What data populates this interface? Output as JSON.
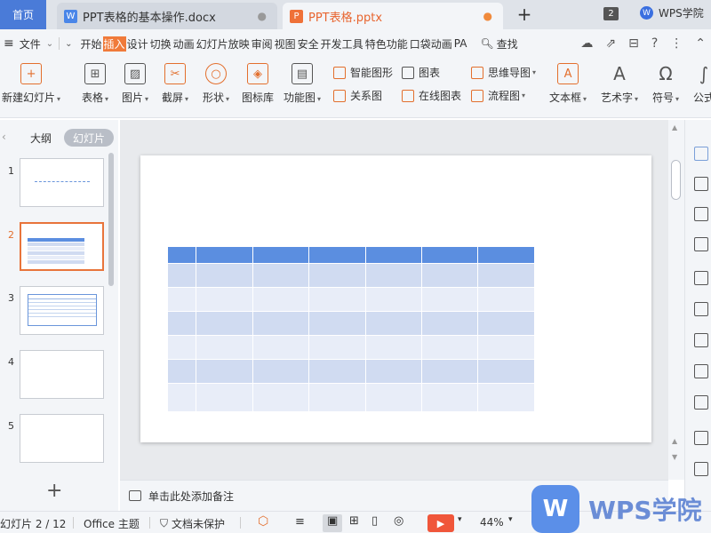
{
  "tabs": {
    "home": "首页",
    "doc": {
      "title": "PPT表格的基本操作.docx",
      "icon": "W"
    },
    "ppt": {
      "title": "PPT表格.pptx",
      "icon": "P"
    },
    "window_count": "2",
    "account": "WPS学院"
  },
  "menu": {
    "file": "文件",
    "tabs": [
      "开始",
      "插入",
      "设计",
      "切换",
      "动画",
      "幻灯片放映",
      "审阅",
      "视图",
      "安全",
      "开发工具",
      "特色功能",
      "口袋动画",
      "PA"
    ],
    "active_tab": "插入",
    "search": "查找"
  },
  "ribbon": {
    "new_slide": "新建幻灯片",
    "table": "表格",
    "picture": "图片",
    "screenshot": "截屏",
    "shape": "形状",
    "icon_lib": "图标库",
    "function_chart": "功能图",
    "smart_graphic": "智能图形",
    "chart": "图表",
    "mind_map": "思维导图",
    "relation_chart": "关系图",
    "online_chart": "在线图表",
    "flow_chart": "流程图",
    "textbox": "文本框",
    "wordart": "艺术字",
    "symbol": "符号",
    "formula": "公式"
  },
  "left_panel": {
    "outline": "大纲",
    "slides": "幻灯片",
    "slide_numbers": [
      "1",
      "2",
      "3",
      "4",
      "5"
    ],
    "active_slide": "2"
  },
  "notes": {
    "placeholder": "单击此处添加备注"
  },
  "status": {
    "slide_position": "幻灯片 2 / 12",
    "theme": "Office 主题",
    "protection": "文档未保护",
    "zoom": "44%"
  },
  "watermark": {
    "logo": "W",
    "text": "WPS学院"
  },
  "table": {
    "columns": 7,
    "rows": 6,
    "header_color": "#5b8ee0",
    "odd_row_color": "#d0dbf1",
    "even_row_color": "#e8edf8"
  }
}
